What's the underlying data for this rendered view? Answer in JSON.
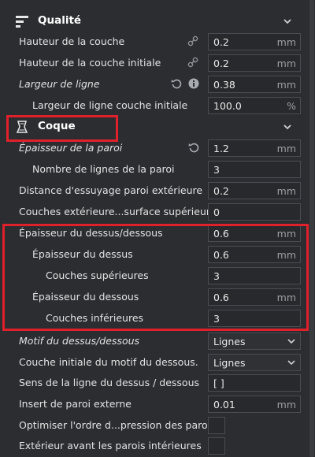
{
  "sections": {
    "quality": {
      "title": "Qualité"
    },
    "shell": {
      "title": "Coque"
    }
  },
  "quality_rows": [
    {
      "label": "Hauteur de la couche",
      "value": "0.2",
      "unit": "mm"
    },
    {
      "label": "Hauteur de la couche initiale",
      "value": "0.2",
      "unit": "mm"
    },
    {
      "label": "Largeur de ligne",
      "value": "0.38",
      "unit": "mm"
    },
    {
      "label": "Largeur de ligne couche initiale",
      "value": "100.0",
      "unit": "%"
    }
  ],
  "shell_rows": [
    {
      "label": "Épaisseur de la paroi",
      "value": "1.2",
      "unit": "mm"
    },
    {
      "label": "Nombre de lignes de la paroi",
      "value": "3",
      "unit": ""
    },
    {
      "label": "Distance d'essuyage paroi extérieure",
      "value": "0.2",
      "unit": "mm"
    },
    {
      "label": "Couches extérieure...surface supérieure",
      "value": "0",
      "unit": ""
    },
    {
      "label": "Épaisseur du dessus/dessous",
      "value": "0.6",
      "unit": "mm"
    },
    {
      "label": "Épaisseur du dessus",
      "value": "0.6",
      "unit": "mm"
    },
    {
      "label": "Couches supérieures",
      "value": "3",
      "unit": ""
    },
    {
      "label": "Épaisseur du dessous",
      "value": "0.6",
      "unit": "mm"
    },
    {
      "label": "Couches inférieures",
      "value": "3",
      "unit": ""
    },
    {
      "label": "Motif du dessus/dessous",
      "value": "Lignes",
      "unit": ""
    },
    {
      "label": "Couche initiale du motif du dessous.",
      "value": "Lignes",
      "unit": ""
    },
    {
      "label": "Sens de la ligne du dessus / dessous",
      "value": "[ ]",
      "unit": ""
    },
    {
      "label": "Insert de paroi externe",
      "value": "0.01",
      "unit": "mm"
    },
    {
      "label": "Optimiser l'ordre d...pression des parois",
      "value": "",
      "unit": ""
    },
    {
      "label": "Extérieur avant les parois intérieures",
      "value": "",
      "unit": ""
    }
  ],
  "colors": {
    "background": "#2b2d31",
    "field_border": "#4a4c51",
    "highlight": "#e0202a",
    "text": "#e3e3e3"
  },
  "icons": {
    "quality": "sliders-icon",
    "shell": "shell-shape-icon",
    "link": "link-icon",
    "reset": "reset-icon",
    "info": "info-icon",
    "chevron": "chevron-down-icon"
  }
}
